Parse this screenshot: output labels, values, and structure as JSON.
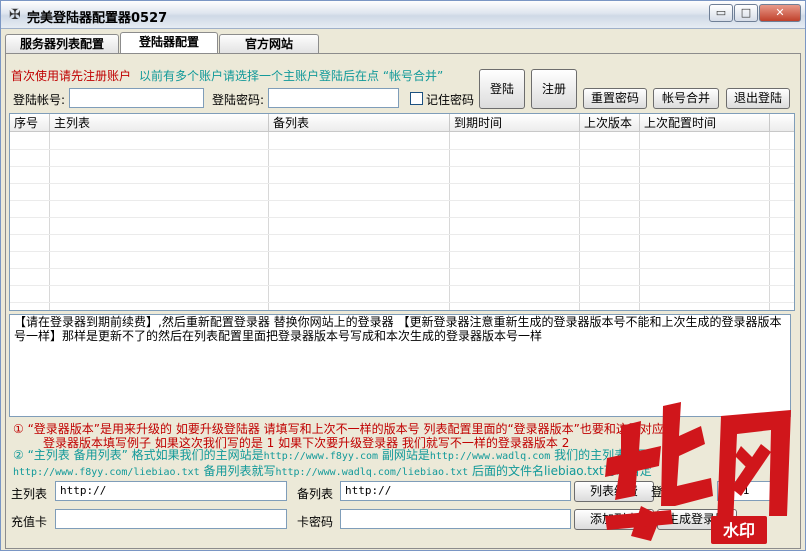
{
  "window": {
    "title": "完美登陆器配置器0527",
    "min": "▭",
    "max": "□",
    "close": "✕"
  },
  "tabs": [
    {
      "label": "服务器列表配置"
    },
    {
      "label": "登陆器配置"
    },
    {
      "label": "官方网站"
    }
  ],
  "hints": {
    "first_use": "首次使用请先注册账户",
    "merge": "以前有多个账户请选择一个主账户登陆后在点 “帐号合并”"
  },
  "login": {
    "account_label": "登陆帐号:",
    "account_value": "",
    "password_label": "登陆密码:",
    "password_value": "",
    "remember_label": "记住密码",
    "remember_checked": false
  },
  "buttons": {
    "login": "登陆",
    "register": "注册",
    "reset_password": "重置密码",
    "merge_account": "帐号合并",
    "logout": "退出登陆"
  },
  "grid": {
    "columns": [
      "序号",
      "主列表",
      "备列表",
      "到期时间",
      "上次版本",
      "上次配置时间"
    ],
    "rows": []
  },
  "notes": "【请在登录器到期前续费】,然后重新配置登录器 替换你网站上的登录器 【更新登录器注意重新生成的登录器版本号不能和上次生成的登录器版本号一样】那样是更新不了的然后在列表配置里面把登录器版本号写成和本次生成的登录器版本号一样",
  "help": {
    "line1": "①  “登录器版本”是用来升级的 如要升级登陆器 请填写和上次不一样的版本号 列表配置里面的“登录器版本”也要和这里对应",
    "line1b": "登录器版本填写例子 如果这次我们写的是 1 如果下次要升级登录器 我们就写不一样的登录器版本 2",
    "line2": "②  “主列表 备用列表”  格式如果我们的主网站是",
    "line2_url1": "http://www.f8yy.com",
    "line2_mid": " 副网站是",
    "line2_url2": "http://www.wadlq.com",
    "line2_end": " 我们的主列表就写",
    "line3_url1": "http://www.f8yy.com/liebiao.txt",
    "line3_mid": " 备用列表就写",
    "line3_url2": "http://www.wadlq.com/liebiao.txt",
    "line3_end": " 后面的文件名liebiao.txt可以自定"
  },
  "form": {
    "main_list_label": "主列表",
    "main_list_value": "http://",
    "backup_list_label": "备列表",
    "backup_list_value": "http://",
    "list_btn": "列表续费",
    "version_label": "登录器版本",
    "version_value": "1",
    "card_label": "充值卡",
    "card_value": "",
    "card_pwd_label": "卡密码",
    "card_pwd_value": "",
    "add_btn": "添加列表",
    "generate_btn": "生成登录器"
  },
  "watermark": {
    "text": "水印",
    "brand_glyphs": "地网"
  },
  "colors": {
    "hint_red": "#c00000",
    "hint_teal": "#119999",
    "watermark_red": "#d0161b"
  }
}
